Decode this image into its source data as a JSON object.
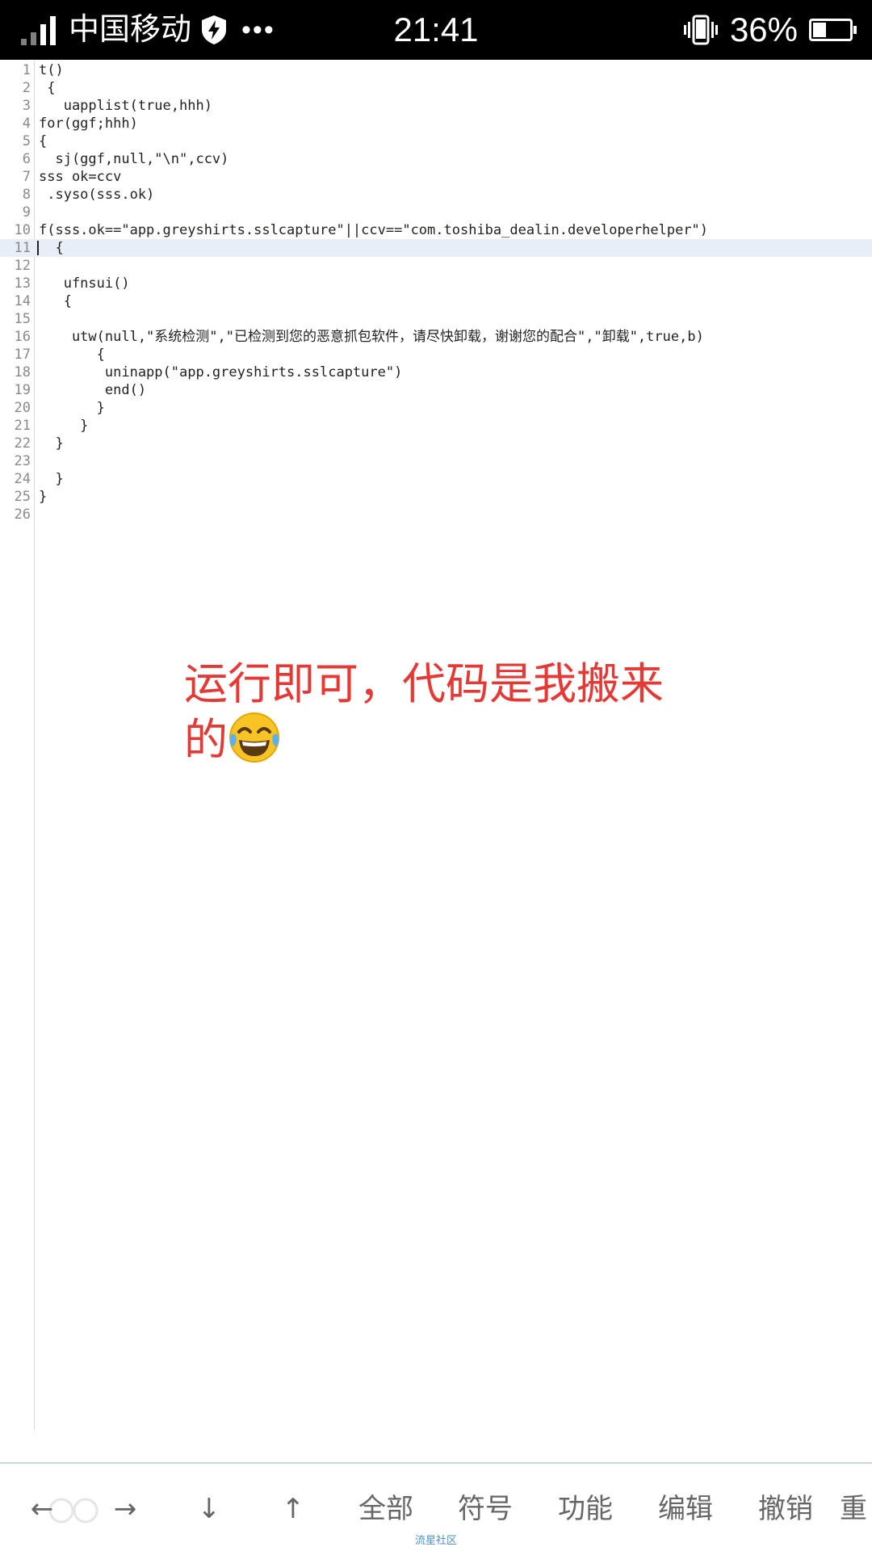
{
  "status_bar": {
    "carrier": "中国移动",
    "dots": "•••",
    "time": "21:41",
    "battery_percent": "36%",
    "battery_level": 0.36
  },
  "editor": {
    "active_line": 11,
    "lines": [
      {
        "num": "1",
        "text": "t()"
      },
      {
        "num": "2",
        "text": " {"
      },
      {
        "num": "3",
        "text": "   uapplist(true,hhh)"
      },
      {
        "num": "4",
        "text": "for(ggf;hhh)"
      },
      {
        "num": "5",
        "text": "{"
      },
      {
        "num": "6",
        "text": "  sj(ggf,null,\"\\n\",ccv)"
      },
      {
        "num": "7",
        "text": "sss ok=ccv"
      },
      {
        "num": "8",
        "text": " .syso(sss.ok)"
      },
      {
        "num": "9",
        "text": ""
      },
      {
        "num": "10",
        "text": "f(sss.ok==\"app.greyshirts.sslcapture\"||ccv==\"com.toshiba_dealin.developerhelper\")"
      },
      {
        "num": "11",
        "text": "  {"
      },
      {
        "num": "12",
        "text": ""
      },
      {
        "num": "13",
        "text": "   ufnsui()"
      },
      {
        "num": "14",
        "text": "   {"
      },
      {
        "num": "15",
        "text": ""
      },
      {
        "num": "16",
        "text": "    utw(null,\"系统检测\",\"已检测到您的恶意抓包软件，请尽快卸载，谢谢您的配合\",\"卸载\",true,b)"
      },
      {
        "num": "17",
        "text": "       {"
      },
      {
        "num": "18",
        "text": "        uninapp(\"app.greyshirts.sslcapture\")"
      },
      {
        "num": "19",
        "text": "        end()"
      },
      {
        "num": "20",
        "text": "       }"
      },
      {
        "num": "21",
        "text": "     }"
      },
      {
        "num": "22",
        "text": "  }"
      },
      {
        "num": "23",
        "text": ""
      },
      {
        "num": "24",
        "text": "  }"
      },
      {
        "num": "25",
        "text": "}"
      },
      {
        "num": "26",
        "text": ""
      }
    ]
  },
  "annotation": {
    "text": "运行即可，代码是我搬来的"
  },
  "toolbar": {
    "keys": [
      {
        "label": "←",
        "icon": "arrow-left-icon"
      },
      {
        "label": "→",
        "icon": "arrow-right-icon"
      },
      {
        "label": "↓",
        "icon": "arrow-down-icon"
      },
      {
        "label": "↑",
        "icon": "arrow-up-icon"
      },
      {
        "label": "全部"
      },
      {
        "label": "符号"
      },
      {
        "label": "功能"
      },
      {
        "label": "编辑"
      },
      {
        "label": "撤销"
      },
      {
        "label": "重"
      }
    ]
  },
  "watermark": "流星社区",
  "colors": {
    "annotation": "#e53935",
    "active_line_bg": "#e8eef8",
    "toolbar_text": "#666666"
  }
}
